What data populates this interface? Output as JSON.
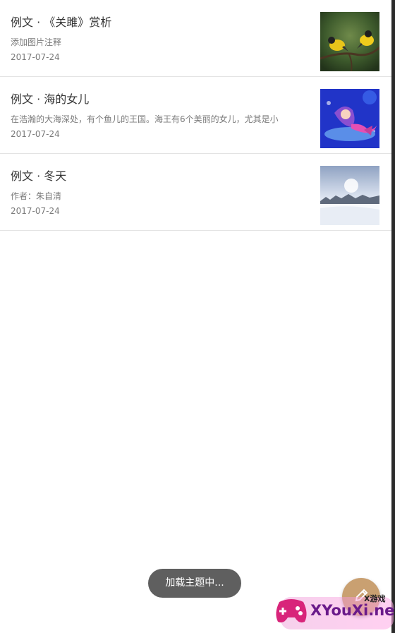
{
  "articles": [
    {
      "title": "例文 · 《关雎》赏析",
      "description": "添加图片注释",
      "date": "2017-07-24",
      "image": "birds-on-branch"
    },
    {
      "title": "例文 · 海的女儿",
      "description": "在浩瀚的大海深处，有个鱼儿的王国。海王有6个美丽的女儿，尤其是小",
      "date": "2017-07-24",
      "image": "mermaid-illustration"
    },
    {
      "title": "例文 · 冬天",
      "description": "作者：朱自清",
      "date": "2017-07-24",
      "image": "winter-snow-landscape"
    }
  ],
  "toast": {
    "text": "加载主题中..."
  },
  "fab": {
    "icon": "edit-pencil-icon",
    "color": "#c9a071"
  },
  "watermark": {
    "text": "XYouXi.net",
    "sub_text": "X游戏"
  }
}
